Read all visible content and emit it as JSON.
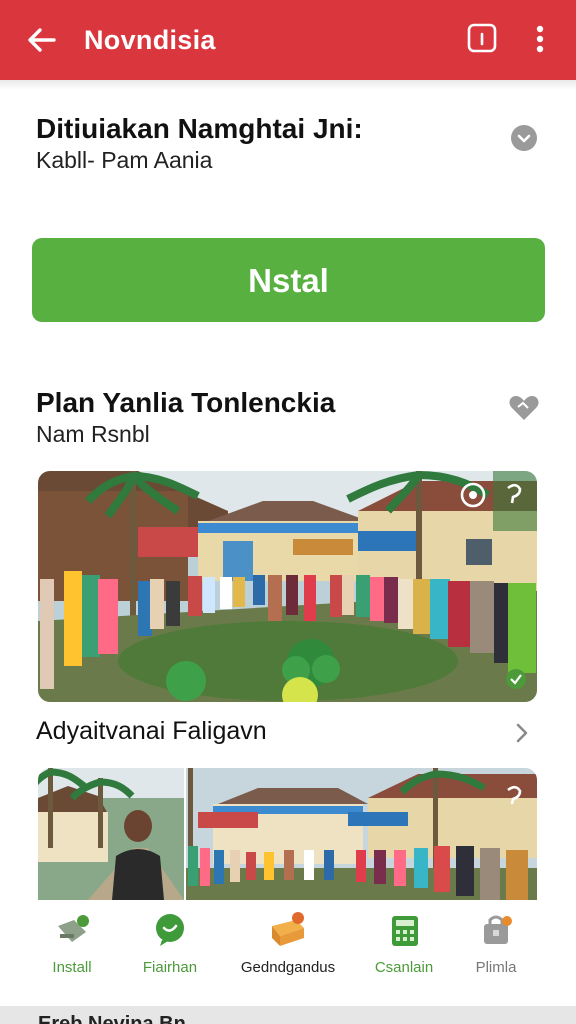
{
  "topbar": {
    "title": "Novndisia",
    "icons": [
      "back-arrow-icon",
      "info-box-icon",
      "more-vertical-icon"
    ]
  },
  "section1": {
    "title": "Ditiuiakan Namghtai Jni:",
    "subtitle": "Kabll- Pam Aania",
    "install_label": "Nstal"
  },
  "section2": {
    "title": "Plan Yanlia Tonlenckia",
    "subtitle": "Nam Rsnbl"
  },
  "gallery": {
    "caption": "Adyaitvanai Faligavn"
  },
  "bottom_nav": [
    {
      "label": "Install",
      "icon": "tag-icon",
      "color": "#4c9a3a"
    },
    {
      "label": "Fiairhan",
      "icon": "chat-bubble-icon",
      "color": "#4c9a3a"
    },
    {
      "label": "Gedndgandus",
      "icon": "package-icon",
      "color": "#222222"
    },
    {
      "label": "Csanlain",
      "icon": "calculator-icon",
      "color": "#4c9a3a"
    },
    {
      "label": "Plimla",
      "icon": "bag-icon",
      "color": "#777777"
    }
  ],
  "bottom_strip_text": "Ereb.Nevina Bn",
  "colors": {
    "header": "#d9363e",
    "install_button": "#58b041",
    "nav_green": "#4c9a3a",
    "nav_orange": "#e88b2c"
  }
}
